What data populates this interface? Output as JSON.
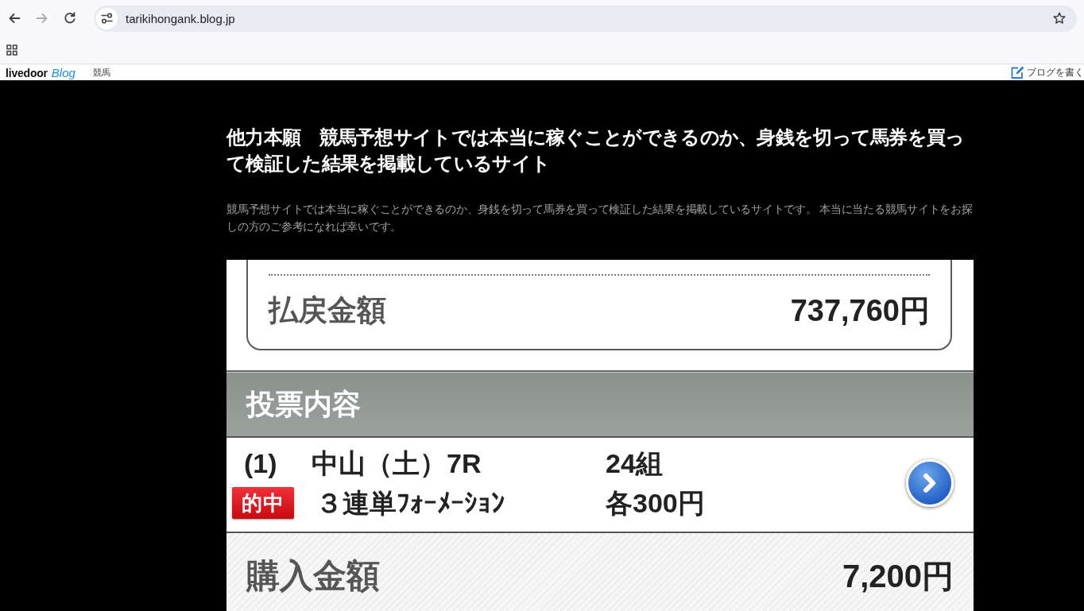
{
  "browser": {
    "nav": [
      {
        "kind": "back",
        "disabled": false
      },
      {
        "kind": "forward",
        "disabled": true
      },
      {
        "kind": "reload",
        "disabled": false
      }
    ],
    "url": "tarikihongank.blog.jp"
  },
  "blog_bar": {
    "logo_word": "livedoor",
    "logo_blog": "Blog",
    "category": "競馬",
    "write_link": "ブログを書く"
  },
  "header": {
    "title": "他力本願　競馬予想サイトでは本当に稼ぐことができるのか、身銭を切って馬券を買って検証した結果を掲載しているサイト",
    "description": "競馬予想サイトでは本当に稼ぐことができるのか、身銭を切って馬券を買って検証した結果を掲載しているサイトです。 本当に当たる競馬サイトをお探しの方のご参考になれば幸いです。"
  },
  "article_image": {
    "payout": {
      "label": "払戻金額",
      "amount": "737,760円"
    },
    "section_title": "投票内容",
    "bets": [
      {
        "number": "(1)",
        "race": "中山（土）7R",
        "badge": "的中",
        "bet_type": "３連単ﾌｫｰﾒｰｼｮﾝ",
        "combinations": "24組",
        "stake": "各300円"
      }
    ],
    "purchase": {
      "label": "購入金額",
      "amount": "7,200円"
    }
  }
}
